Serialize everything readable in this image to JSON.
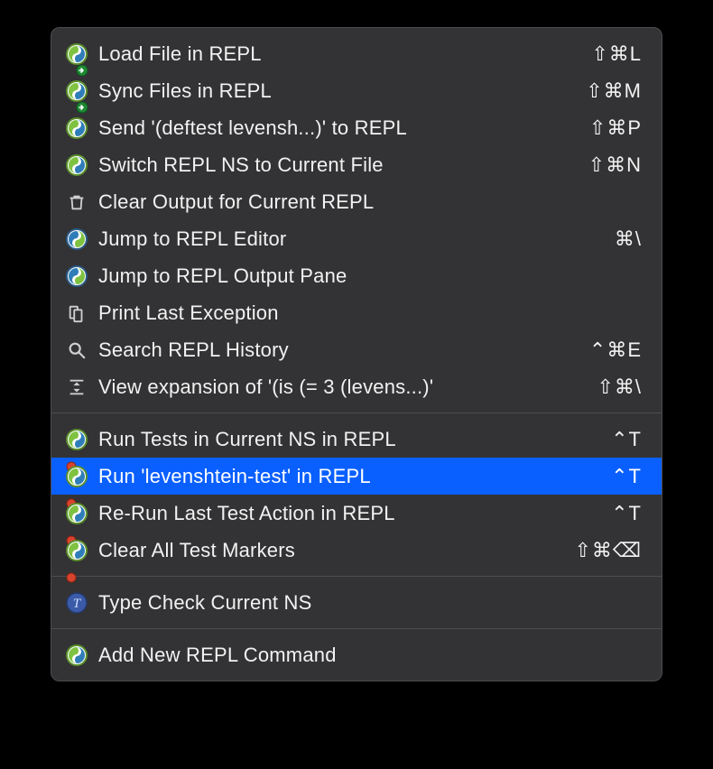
{
  "menu": {
    "groups": [
      {
        "items": [
          {
            "icon": "clj-arrow-green",
            "label": "Load File in REPL",
            "shortcut": "⇧⌘L"
          },
          {
            "icon": "clj-arrow-green",
            "label": "Sync Files in REPL",
            "shortcut": "⇧⌘M"
          },
          {
            "icon": "clj-green",
            "label": "Send '(deftest levensh...)' to REPL",
            "shortcut": "⇧⌘P"
          },
          {
            "icon": "clj-green",
            "label": "Switch REPL NS to Current File",
            "shortcut": "⇧⌘N"
          },
          {
            "icon": "trash",
            "label": "Clear Output for Current REPL",
            "shortcut": ""
          },
          {
            "icon": "clj-blue",
            "label": "Jump to REPL Editor",
            "shortcut": "⌘\\"
          },
          {
            "icon": "clj-blue",
            "label": "Jump to REPL Output Pane",
            "shortcut": ""
          },
          {
            "icon": "print",
            "label": "Print Last Exception",
            "shortcut": ""
          },
          {
            "icon": "search",
            "label": "Search REPL History",
            "shortcut": "⌃⌘E"
          },
          {
            "icon": "expand",
            "label": "View expansion of '(is (= 3 (levens...)'",
            "shortcut": "⇧⌘\\"
          }
        ]
      },
      {
        "items": [
          {
            "icon": "clj-test",
            "label": "Run Tests in Current NS in REPL",
            "shortcut": "⌃T"
          },
          {
            "icon": "clj-test",
            "label": "Run 'levenshtein-test' in REPL",
            "shortcut": "⌃T",
            "selected": true
          },
          {
            "icon": "clj-test",
            "label": "Re-Run Last Test Action in REPL",
            "shortcut": "⌃T"
          },
          {
            "icon": "clj-test",
            "label": "Clear All Test Markers",
            "shortcut": "⇧⌘⌫"
          }
        ]
      },
      {
        "items": [
          {
            "icon": "type-check",
            "label": "Type Check Current NS",
            "shortcut": ""
          }
        ]
      },
      {
        "items": [
          {
            "icon": "clj-green",
            "label": "Add New REPL Command",
            "shortcut": ""
          }
        ]
      }
    ]
  }
}
